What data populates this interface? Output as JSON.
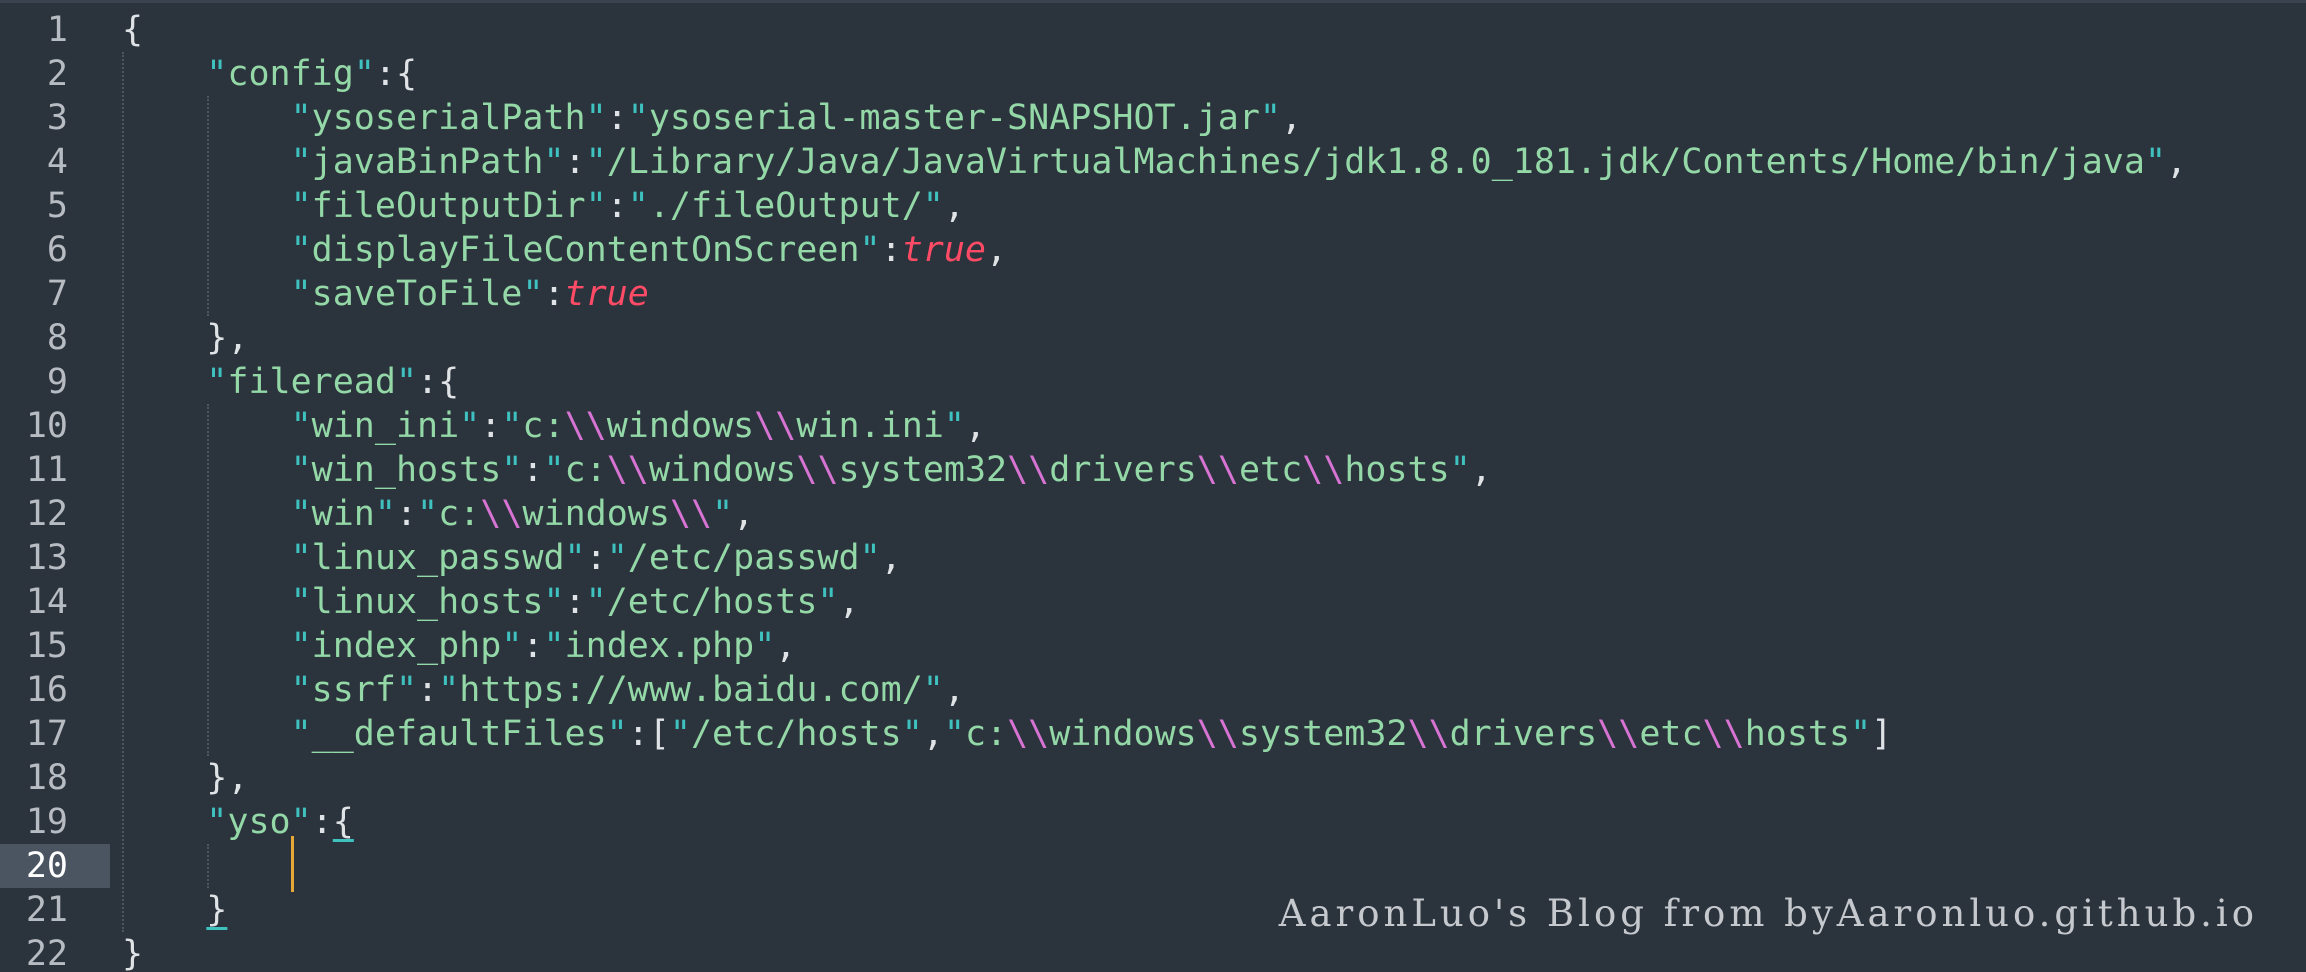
{
  "editor": {
    "active_line": 20,
    "line_numbers": [
      "1",
      "2",
      "3",
      "4",
      "5",
      "6",
      "7",
      "8",
      "9",
      "10",
      "11",
      "12",
      "13",
      "14",
      "15",
      "16",
      "17",
      "18",
      "19",
      "20",
      "21",
      "22"
    ],
    "watermark": "AaronLuo's Blog from byAaronluo.github.io",
    "colors": {
      "background": "#2b333d",
      "string": "#93d8a6",
      "quote": "#3fc1c0",
      "escape": "#d774d3",
      "boolean": "#ff4b65",
      "cursor": "#e8a838"
    }
  },
  "code": {
    "config_key": "config",
    "ysoserialPath_key": "ysoserialPath",
    "ysoserialPath_val": "ysoserial-master-SNAPSHOT.jar",
    "javaBinPath_key": "javaBinPath",
    "javaBinPath_val": "/Library/Java/JavaVirtualMachines/jdk1.8.0_181.jdk/Contents/Home/bin/java",
    "fileOutputDir_key": "fileOutputDir",
    "fileOutputDir_val": "./fileOutput/",
    "displayFileContentOnScreen_key": "displayFileContentOnScreen",
    "displayFileContentOnScreen_val": "true",
    "saveToFile_key": "saveToFile",
    "saveToFile_val": "true",
    "fileread_key": "fileread",
    "win_ini_key": "win_ini",
    "win_hosts_key": "win_hosts",
    "win_key": "win",
    "linux_passwd_key": "linux_passwd",
    "linux_passwd_val": "/etc/passwd",
    "linux_hosts_key": "linux_hosts",
    "linux_hosts_val": "/etc/hosts",
    "index_php_key": "index_php",
    "index_php_val": "index.php",
    "ssrf_key": "ssrf",
    "ssrf_val": "https://www.baidu.com/",
    "defaultFiles_key": "__defaultFiles",
    "defaultFiles_val1": "/etc/hosts",
    "yso_key": "yso",
    "t_c": "c:",
    "t_windows": "windows",
    "t_win_ini": "win.ini",
    "t_system32": "system32",
    "t_drivers": "drivers",
    "t_etc": "etc",
    "t_hosts": "hosts",
    "t_bs": "\\\\"
  }
}
